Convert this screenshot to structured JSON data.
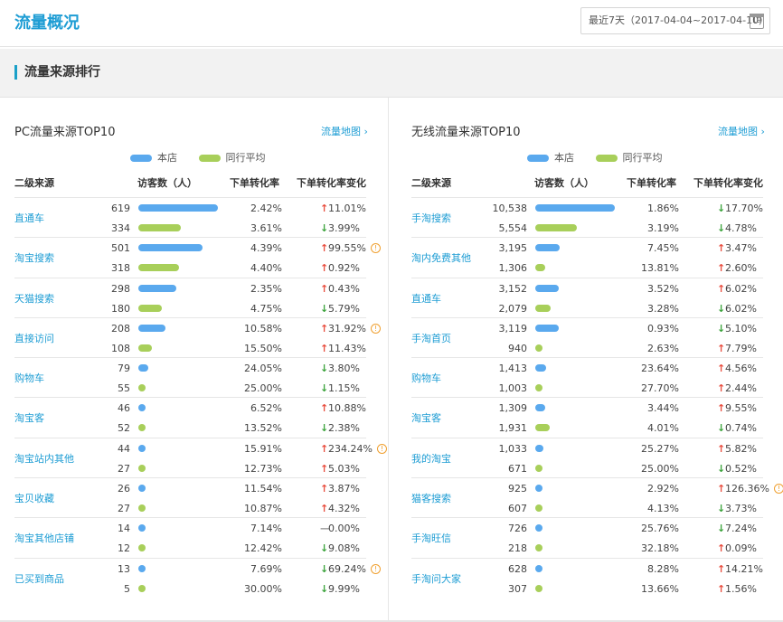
{
  "header": {
    "title": "流量概况",
    "date_range": "最近7天（2017-04-04~2017-04-10）",
    "calendar_day": "19"
  },
  "section": {
    "title": "流量来源排行"
  },
  "colors": {
    "self": "#5aa9ee",
    "peer": "#a8cf5a",
    "accent": "#1e9dd4",
    "up": "#e84c3d",
    "down": "#3aa23a"
  },
  "legend": {
    "self": "本店",
    "peer": "同行平均"
  },
  "columns": {
    "source": "二级来源",
    "visitors": "访客数（人）",
    "rate": "下单转化率",
    "change": "下单转化率变化"
  },
  "panels": [
    {
      "title": "PC流量来源TOP10",
      "link": "流量地图 ›",
      "max": 619,
      "rows": [
        {
          "source": "直通车",
          "self": {
            "count": "619",
            "value": 619,
            "rate": "2.42%",
            "dir": "up",
            "change": "11.01%"
          },
          "peer": {
            "count": "334",
            "value": 334,
            "rate": "3.61%",
            "dir": "down",
            "change": "3.99%"
          }
        },
        {
          "source": "淘宝搜索",
          "self": {
            "count": "501",
            "value": 501,
            "rate": "4.39%",
            "dir": "up",
            "change": "99.55%",
            "warn": true
          },
          "peer": {
            "count": "318",
            "value": 318,
            "rate": "4.40%",
            "dir": "up",
            "change": "0.92%"
          }
        },
        {
          "source": "天猫搜索",
          "self": {
            "count": "298",
            "value": 298,
            "rate": "2.35%",
            "dir": "up",
            "change": "0.43%"
          },
          "peer": {
            "count": "180",
            "value": 180,
            "rate": "4.75%",
            "dir": "down",
            "change": "5.79%"
          }
        },
        {
          "source": "直接访问",
          "self": {
            "count": "208",
            "value": 208,
            "rate": "10.58%",
            "dir": "up",
            "change": "31.92%",
            "warn": true
          },
          "peer": {
            "count": "108",
            "value": 108,
            "rate": "15.50%",
            "dir": "up",
            "change": "11.43%"
          }
        },
        {
          "source": "购物车",
          "self": {
            "count": "79",
            "value": 79,
            "rate": "24.05%",
            "dir": "down",
            "change": "3.80%"
          },
          "peer": {
            "count": "55",
            "value": 55,
            "rate": "25.00%",
            "dir": "down",
            "change": "1.15%"
          }
        },
        {
          "source": "淘宝客",
          "self": {
            "count": "46",
            "value": 46,
            "rate": "6.52%",
            "dir": "up",
            "change": "10.88%"
          },
          "peer": {
            "count": "52",
            "value": 52,
            "rate": "13.52%",
            "dir": "down",
            "change": "2.38%"
          }
        },
        {
          "source": "淘宝站内其他",
          "self": {
            "count": "44",
            "value": 44,
            "rate": "15.91%",
            "dir": "up",
            "change": "234.24%",
            "warn": true
          },
          "peer": {
            "count": "27",
            "value": 27,
            "rate": "12.73%",
            "dir": "up",
            "change": "5.03%"
          }
        },
        {
          "source": "宝贝收藏",
          "self": {
            "count": "26",
            "value": 26,
            "rate": "11.54%",
            "dir": "up",
            "change": "3.87%"
          },
          "peer": {
            "count": "27",
            "value": 27,
            "rate": "10.87%",
            "dir": "up",
            "change": "4.32%"
          }
        },
        {
          "source": "淘宝其他店铺",
          "self": {
            "count": "14",
            "value": 14,
            "rate": "7.14%",
            "dir": "flat",
            "change": "0.00%"
          },
          "peer": {
            "count": "12",
            "value": 12,
            "rate": "12.42%",
            "dir": "down",
            "change": "9.08%"
          }
        },
        {
          "source": "已买到商品",
          "self": {
            "count": "13",
            "value": 13,
            "rate": "7.69%",
            "dir": "down",
            "change": "69.24%",
            "warn": true
          },
          "peer": {
            "count": "5",
            "value": 5,
            "rate": "30.00%",
            "dir": "down",
            "change": "9.99%"
          }
        }
      ]
    },
    {
      "title": "无线流量来源TOP10",
      "link": "流量地图 ›",
      "max": 10538,
      "rows": [
        {
          "source": "手淘搜索",
          "self": {
            "count": "10,538",
            "value": 10538,
            "rate": "1.86%",
            "dir": "down",
            "change": "17.70%"
          },
          "peer": {
            "count": "5,554",
            "value": 5554,
            "rate": "3.19%",
            "dir": "down",
            "change": "4.78%"
          }
        },
        {
          "source": "淘内免费其他",
          "self": {
            "count": "3,195",
            "value": 3195,
            "rate": "7.45%",
            "dir": "up",
            "change": "3.47%"
          },
          "peer": {
            "count": "1,306",
            "value": 1306,
            "rate": "13.81%",
            "dir": "up",
            "change": "2.60%"
          }
        },
        {
          "source": "直通车",
          "self": {
            "count": "3,152",
            "value": 3152,
            "rate": "3.52%",
            "dir": "up",
            "change": "6.02%"
          },
          "peer": {
            "count": "2,079",
            "value": 2079,
            "rate": "3.28%",
            "dir": "down",
            "change": "6.02%"
          }
        },
        {
          "source": "手淘首页",
          "self": {
            "count": "3,119",
            "value": 3119,
            "rate": "0.93%",
            "dir": "down",
            "change": "5.10%"
          },
          "peer": {
            "count": "940",
            "value": 940,
            "rate": "2.63%",
            "dir": "up",
            "change": "7.79%"
          }
        },
        {
          "source": "购物车",
          "self": {
            "count": "1,413",
            "value": 1413,
            "rate": "23.64%",
            "dir": "up",
            "change": "4.56%"
          },
          "peer": {
            "count": "1,003",
            "value": 1003,
            "rate": "27.70%",
            "dir": "up",
            "change": "2.44%"
          }
        },
        {
          "source": "淘宝客",
          "self": {
            "count": "1,309",
            "value": 1309,
            "rate": "3.44%",
            "dir": "up",
            "change": "9.55%"
          },
          "peer": {
            "count": "1,931",
            "value": 1931,
            "rate": "4.01%",
            "dir": "down",
            "change": "0.74%"
          }
        },
        {
          "source": "我的淘宝",
          "self": {
            "count": "1,033",
            "value": 1033,
            "rate": "25.27%",
            "dir": "up",
            "change": "5.82%"
          },
          "peer": {
            "count": "671",
            "value": 671,
            "rate": "25.00%",
            "dir": "down",
            "change": "0.52%"
          }
        },
        {
          "source": "猫客搜索",
          "self": {
            "count": "925",
            "value": 925,
            "rate": "2.92%",
            "dir": "up",
            "change": "126.36%",
            "warn": true
          },
          "peer": {
            "count": "607",
            "value": 607,
            "rate": "4.13%",
            "dir": "down",
            "change": "3.73%"
          }
        },
        {
          "source": "手淘旺信",
          "self": {
            "count": "726",
            "value": 726,
            "rate": "25.76%",
            "dir": "down",
            "change": "7.24%"
          },
          "peer": {
            "count": "218",
            "value": 218,
            "rate": "32.18%",
            "dir": "up",
            "change": "0.09%"
          }
        },
        {
          "source": "手淘问大家",
          "self": {
            "count": "628",
            "value": 628,
            "rate": "8.28%",
            "dir": "up",
            "change": "14.21%"
          },
          "peer": {
            "count": "307",
            "value": 307,
            "rate": "13.66%",
            "dir": "up",
            "change": "1.56%"
          }
        }
      ]
    }
  ]
}
